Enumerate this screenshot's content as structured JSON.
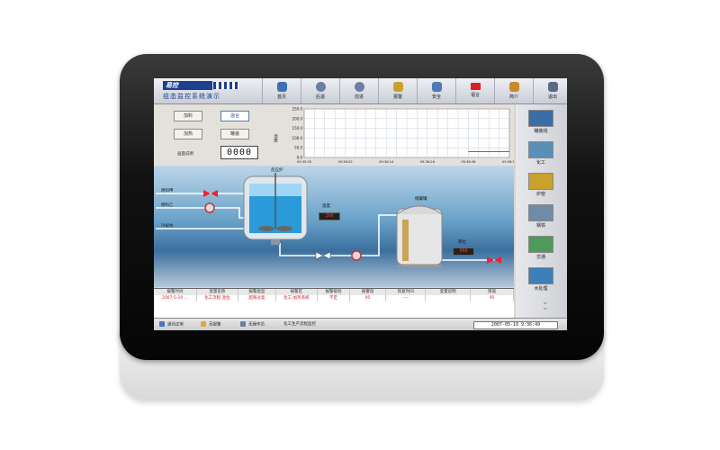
{
  "app": {
    "logo_text": "易控",
    "title": "组态监控系统演示"
  },
  "nav": [
    {
      "label": "首页",
      "icon": "home-icon",
      "color": "#3f6fb7"
    },
    {
      "label": "后退",
      "icon": "back-icon",
      "color": "#6b7fa8"
    },
    {
      "label": "前进",
      "icon": "forward-icon",
      "color": "#6b7fa8"
    },
    {
      "label": "报警",
      "icon": "alarm-bell-icon",
      "color": "#c9a12c"
    },
    {
      "label": "安全",
      "icon": "shield-icon",
      "color": "#4f78b8"
    },
    {
      "label": "语言",
      "icon": "flag-icon",
      "color": "#d8201c"
    },
    {
      "label": "简介",
      "icon": "info-icon",
      "color": "#c98a2a"
    },
    {
      "label": "退出",
      "icon": "exit-icon",
      "color": "#5a6a86"
    }
  ],
  "controls": {
    "add_material": "加料",
    "mix": "混合",
    "heat": "加热",
    "tank": "罐装",
    "screen_note": "画面说明",
    "counter": "0000"
  },
  "chart_data": {
    "type": "line",
    "ylabel": "温度",
    "ylim": [
      0,
      250
    ],
    "yticks": [
      "250.0",
      "200.0",
      "150.0",
      "100.0",
      "50.0",
      "0.0"
    ],
    "xticks": [
      "09:35:50",
      "09:36:02",
      "09:36:14",
      "09:36:26",
      "09:36:38",
      "09:36:50"
    ],
    "grid": true,
    "series": [
      {
        "color": "#e21c1c",
        "x": [
          "09:36:38",
          "09:36:50"
        ],
        "values": [
          30,
          30
        ]
      }
    ]
  },
  "process": {
    "reactor": "反应炉",
    "feed_a": "原料甲",
    "feed_b": "原料乙",
    "water": "冷却水",
    "temperature_label": "温度",
    "temperature_value": "260",
    "storage_tank": "储藏罐",
    "flow_label": "液位",
    "flow_value": "008"
  },
  "alarm_table": {
    "headers": [
      "报警时间",
      "变量名称",
      "报警类型",
      "报警区",
      "报警级别",
      "报警值",
      "恢复时间",
      "变量说明",
      "限值"
    ],
    "rows": [
      [
        "2007-5-10 ...",
        "化工流程.温位",
        "超限过高",
        "化工-加热系统",
        "不定",
        "95",
        "----",
        "",
        "95"
      ]
    ]
  },
  "status_bar": {
    "comm": "通讯正常",
    "alarm": "无报警",
    "operator": "无操作员",
    "screen": "化工生产流程监控",
    "datetime": "2007-05-10  9:36:49"
  },
  "side_nav": [
    {
      "label": "罐装线",
      "color": "#3a6ea8"
    },
    {
      "label": "化工",
      "color": "#5b8fb8"
    },
    {
      "label": "炉窑",
      "color": "#c9a12c"
    },
    {
      "label": "钢铁",
      "color": "#6f8ba8"
    },
    {
      "label": "交通",
      "color": "#4f9a5a"
    },
    {
      "label": "水处理",
      "color": "#3d7fb8"
    }
  ]
}
